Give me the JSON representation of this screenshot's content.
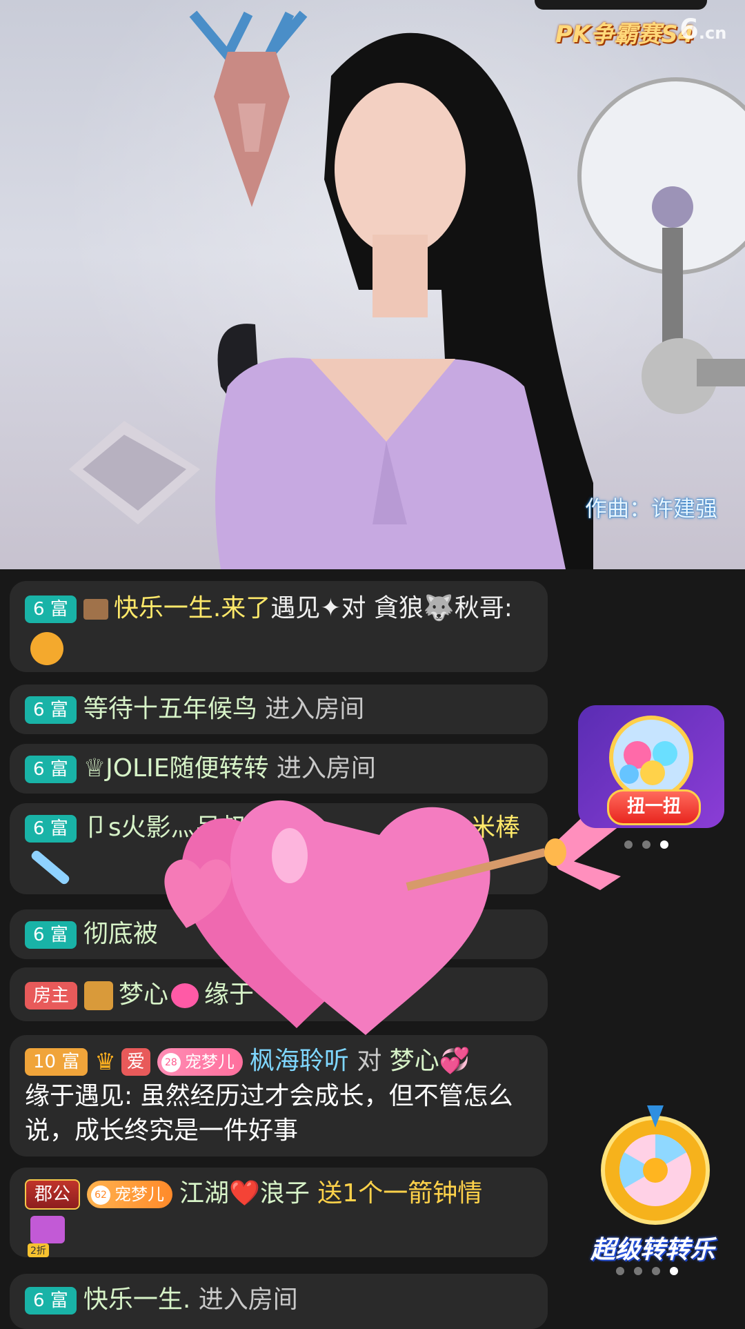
{
  "stream": {
    "event_logo": "PK争霸赛S4",
    "site_logo_main": "6",
    "site_logo_tld": ".cn",
    "song_credit": "作曲：许建强"
  },
  "chat": [
    {
      "badge": "6 富",
      "user": "快乐一生.",
      "action": "来了",
      "extra": "遇见✦对 貪狼🐺秋哥:"
    },
    {
      "badge": "6 富",
      "user": "等待十五年候鸟",
      "action": "进入房间"
    },
    {
      "badge": "6 富",
      "user": "♕JOLIE随便转转",
      "action": "进入房间"
    },
    {
      "badge": "6 富",
      "user": "卩s火影灬呆叔",
      "action": "",
      "extra": "米棒"
    },
    {
      "badge": "6 富",
      "user": "彻底被"
    },
    {
      "badge": "房主",
      "user": "梦心",
      "extra": "缘于"
    },
    {
      "badge": "10 富",
      "tag1": "爱",
      "pill_level": "28",
      "pill_name": "宠梦儿",
      "user": "枫海聆听",
      "to_word": "对",
      "target": "梦心💞",
      "message": "缘于遇见: 虽然经历过才会成长，但不管怎么说，成长终究是一件好事"
    },
    {
      "badge": "郡公",
      "pill_level": "62",
      "pill_name": "宠梦儿",
      "user": "江湖❤️浪子",
      "gift_text": "送1个一箭钟情",
      "gift_badge": "2折"
    },
    {
      "badge": "6 富",
      "user": "快乐一生.",
      "action": "进入房间"
    }
  ],
  "widgets": {
    "gashapon_label": "扭一扭",
    "wheel_label": "超级转转乐"
  },
  "colors": {
    "badge_teal": "#19b3a7",
    "badge_orange": "#f0a43a",
    "chat_bg": "#2a2a2a",
    "username_yellow": "#ffe96a"
  }
}
